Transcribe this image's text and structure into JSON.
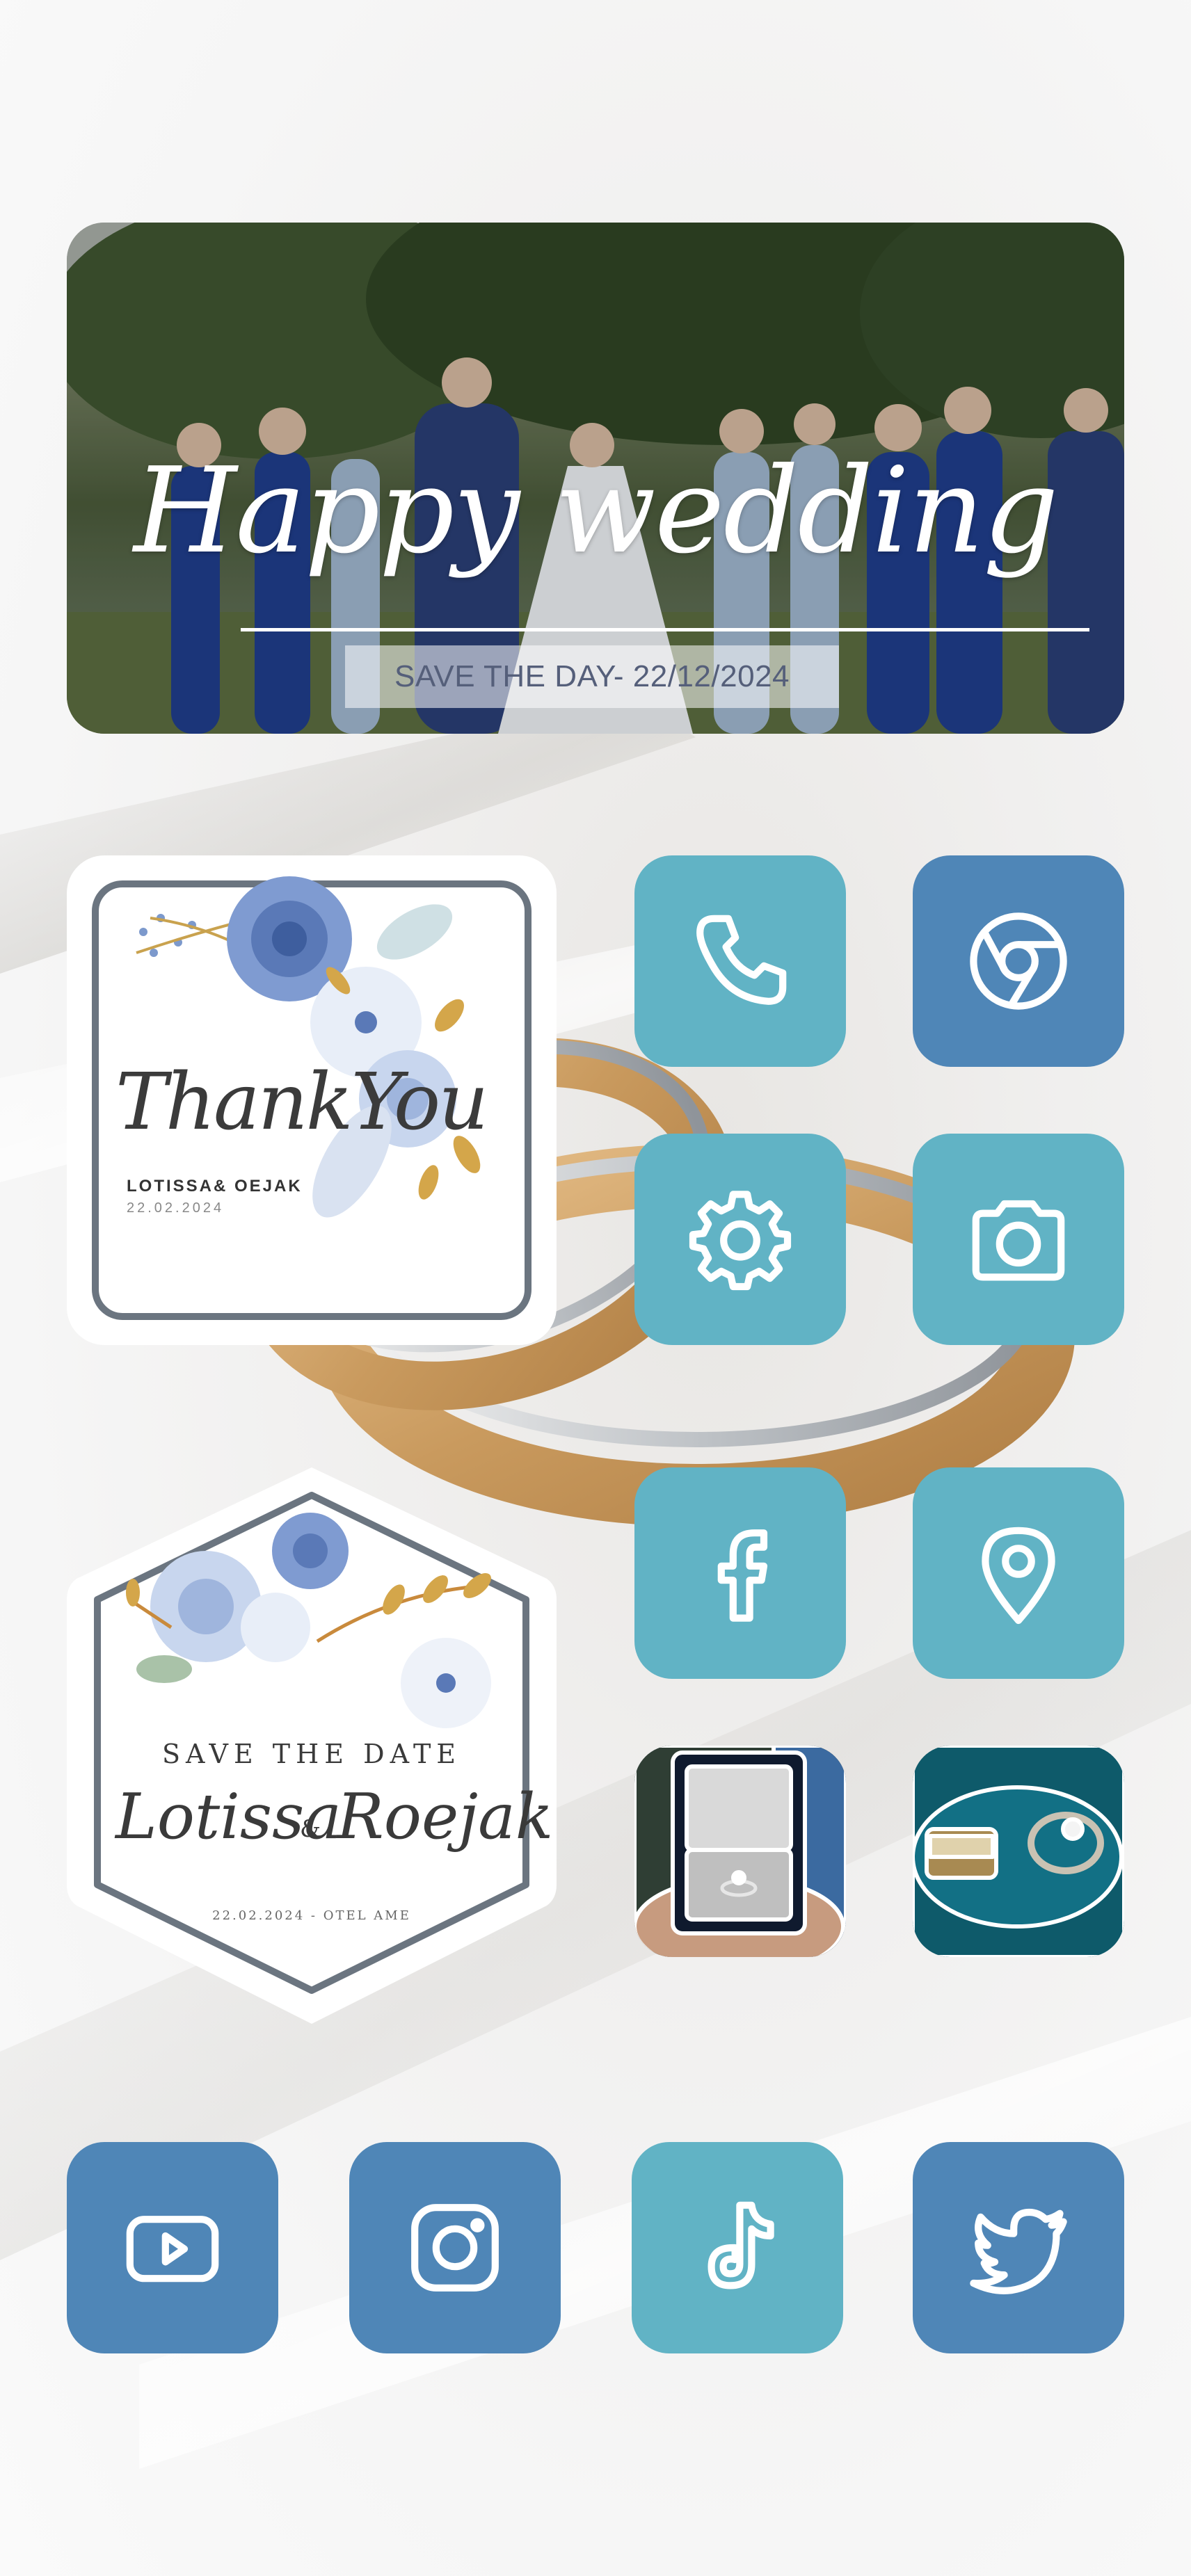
{
  "banner": {
    "title": "Happy wedding",
    "date_text": "SAVE THE DAY- 22/12/2024"
  },
  "thank_you_card": {
    "script": "ThankYou",
    "names": "LOTISSA& OEJAK",
    "date": "22.02.2024"
  },
  "save_the_date_card": {
    "title": "SAVE THE DATE",
    "name1": "Lotissa",
    "ampersand": "&",
    "name2": "Roejak",
    "footer": "22.02.2024 - OTEL AME"
  },
  "apps": [
    {
      "name": "phone",
      "icon": "phone-icon",
      "color": "#61b3c5"
    },
    {
      "name": "chrome",
      "icon": "chrome-icon",
      "color": "#4f86b7"
    },
    {
      "name": "settings",
      "icon": "gear-icon",
      "color": "#61b3c5"
    },
    {
      "name": "camera",
      "icon": "camera-icon",
      "color": "#61b3c5"
    },
    {
      "name": "facebook",
      "icon": "facebook-icon",
      "color": "#61b3c5"
    },
    {
      "name": "maps",
      "icon": "map-pin-icon",
      "color": "#61b3c5"
    },
    {
      "name": "photo-ring-box",
      "icon": "engagement-ring-box-photo"
    },
    {
      "name": "photo-wedding-rings",
      "icon": "wedding-rings-photo"
    },
    {
      "name": "youtube",
      "icon": "youtube-icon",
      "color": "#4f86b7"
    },
    {
      "name": "instagram",
      "icon": "instagram-icon",
      "color": "#4f86b7"
    },
    {
      "name": "tiktok",
      "icon": "tiktok-icon",
      "color": "#61b3c5"
    },
    {
      "name": "twitter",
      "icon": "twitter-icon",
      "color": "#4f86b7"
    }
  ],
  "colors": {
    "teal": "#61b3c5",
    "blue": "#4f86b7",
    "frame_gray": "#6b7580",
    "background": "#f4f4f4"
  }
}
